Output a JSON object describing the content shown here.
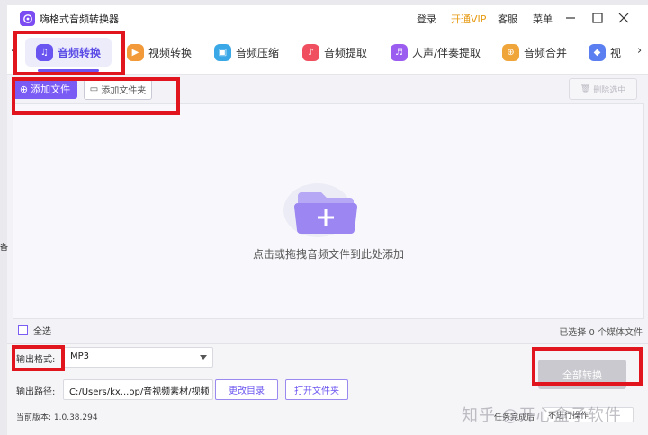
{
  "app": {
    "title": "嗨格式音频转换器"
  },
  "titlebar": {
    "login": "登录",
    "vip": "开通VIP",
    "service": "客服",
    "menu": "菜单"
  },
  "tabs": [
    {
      "label": "音频转换",
      "color": "#6a55f0"
    },
    {
      "label": "视频转换",
      "color": "#f29a3a"
    },
    {
      "label": "音频压缩",
      "color": "#3aa7e6"
    },
    {
      "label": "音频提取",
      "color": "#ef4f5f"
    },
    {
      "label": "人声/伴奏提取",
      "color": "#9b5cf0"
    },
    {
      "label": "音频合并",
      "color": "#f0a53a"
    },
    {
      "label": "视",
      "color": "#5b7ff0"
    }
  ],
  "toolbar": {
    "add_file": "添加文件",
    "add_folder": "添加文件夹",
    "delete_selected": "删除选中"
  },
  "dropzone": {
    "hint": "点击或拖拽音频文件到此处添加"
  },
  "list": {
    "select_all": "全选",
    "selected_count": "已选择 0 个媒体文件"
  },
  "output": {
    "format_label": "输出格式:",
    "format_value": "MP3",
    "path_label": "输出路径:",
    "path_value": "C:/Users/kx...op/音视频素材/视频",
    "change_dir": "更改目录",
    "open_folder": "打开文件夹",
    "convert_all": "全部转换"
  },
  "footer": {
    "version": "当前版本: 1.0.38.294",
    "task_status": "任务完成后",
    "after_action": "不进行操作",
    "watermark": "知乎 @开心盒子软件"
  },
  "edge": {
    "left_text": "备"
  },
  "colors": {
    "accent": "#7a5cf5",
    "annotation_red": "#e0151e",
    "vip": "#e69a12"
  }
}
